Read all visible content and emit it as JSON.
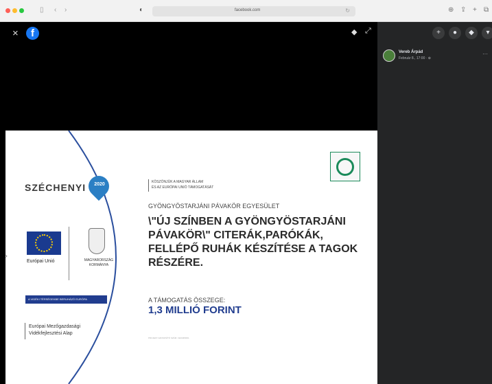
{
  "browser": {
    "url": "facebook.com",
    "back_label": "‹",
    "forward_label": "›",
    "sidebar_icon": "sidebar-icon",
    "reload_label": "↻",
    "shield_label": "◐",
    "right_icons": [
      "⊕",
      "⇪",
      "+",
      "⧉"
    ]
  },
  "viewer": {
    "close_label": "×",
    "logo_letter": "f",
    "tag_label": "◆",
    "expand_label": "⤢"
  },
  "poster": {
    "szechenyi": "SZÉCHENYI",
    "program_year": "2020",
    "eu_label": "Európai Unió",
    "gov_label": "MAGYARORSZÁG KORMÁNYA",
    "bluebar_text": "A VIDÉKI TÉRSÉGEKBE BERUHÁZÓ EURÓPA",
    "fund_line1": "Európai Mezőgazdasági",
    "fund_line2": "Vidékfejlesztési Alap",
    "thanks_line1": "KÖSZÖNJÜK A MAGYAR ÁLLAM",
    "thanks_line2": "ÉS AZ EURÓPAI UNIÓ TÁMOGATÁSÁT",
    "association": "GYÖNGYÖSTARJÁNI PÁVAKÖR EGYESÜLET",
    "title": "\\\"ÚJ SZÍNBEN A GYÖNGYÖSTARJÁNI PÁVAKÖR\\\" CITERÁK,PARÓKÁK, FELLÉPŐ RUHÁK KÉSZÍTÉSE A TAGOK RÉSZÉRE.",
    "amount_label": "A TÁMOGATÁS ÖSSZEGE:",
    "amount": "1,3 MILLIÓ FORINT",
    "footnote": "PROJEKT AZONOSÍTÓ SZÁM: 1921983061"
  },
  "panel": {
    "buttons": [
      "+",
      "●",
      "◆",
      "▾"
    ],
    "poster_name": "Vereb Árpád",
    "poster_date": "Február 8., 17:00 · ⊕",
    "more_label": "···"
  },
  "colors": {
    "fb_blue": "#1877f2",
    "poster_navy": "#213d8f",
    "panel_bg": "#242526"
  }
}
